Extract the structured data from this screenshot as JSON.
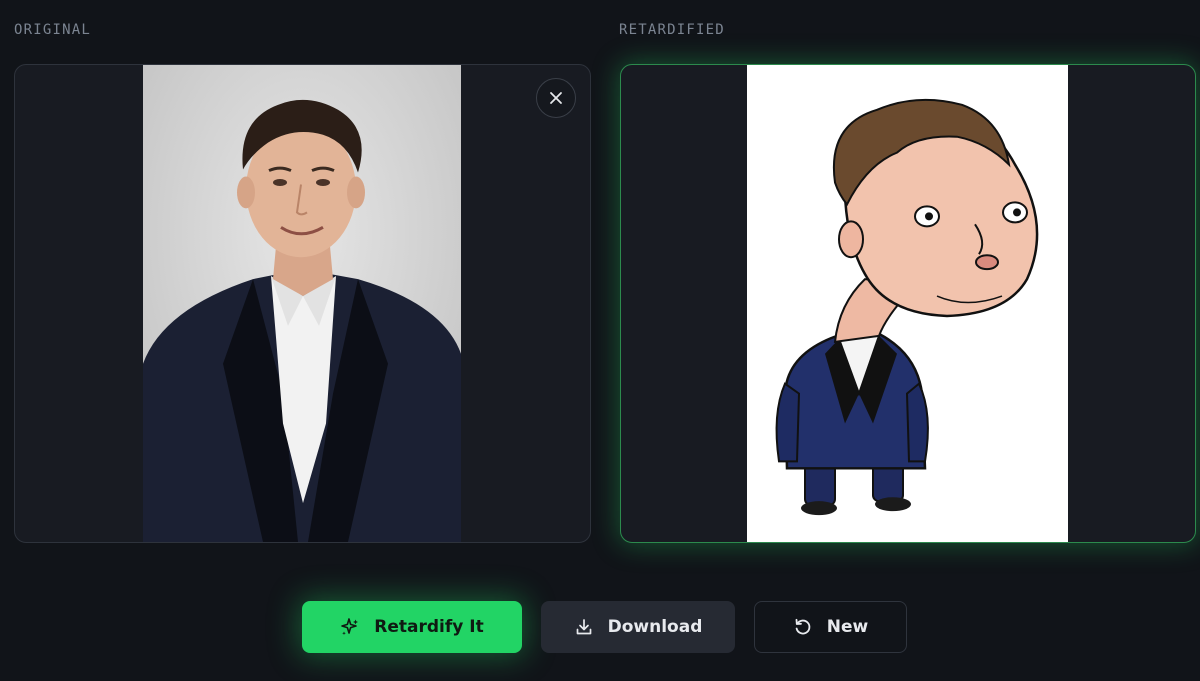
{
  "panels": {
    "original": {
      "label": "ORIGINAL"
    },
    "result": {
      "label": "RETARDIFIED"
    }
  },
  "actions": {
    "generate_label": "Retardify It",
    "download_label": "Download",
    "new_label": "New"
  },
  "icons": {
    "close": "close-icon",
    "generate": "sparkles-icon",
    "download": "download-icon",
    "new": "refresh-icon"
  },
  "colors": {
    "accent": "#22d465",
    "background": "#111419",
    "panel": "#181b22"
  }
}
